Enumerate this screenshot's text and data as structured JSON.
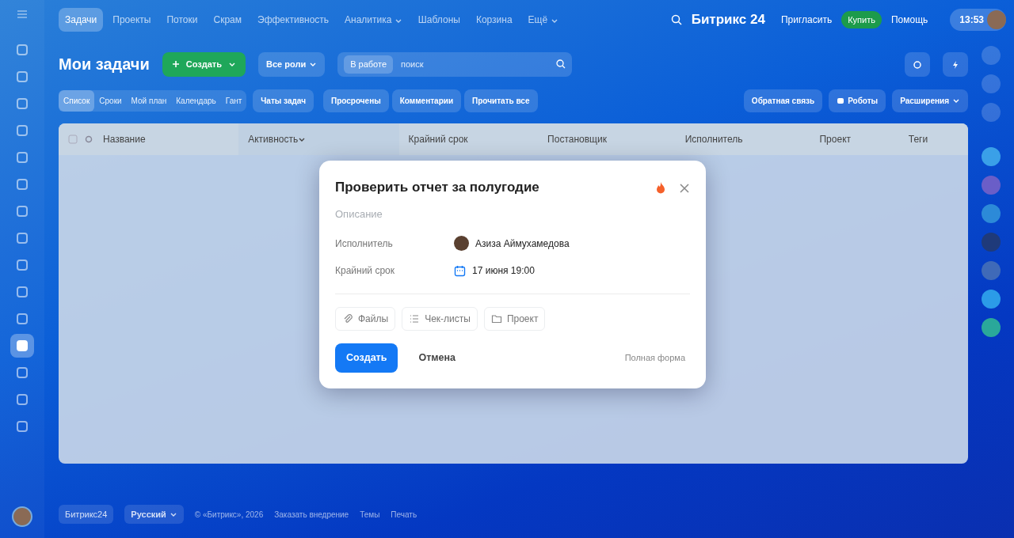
{
  "top_nav": {
    "items": [
      {
        "label": "Задачи",
        "selected": true,
        "has_menu": false
      },
      {
        "label": "Проекты",
        "selected": false,
        "has_menu": false
      },
      {
        "label": "Потоки",
        "selected": false,
        "has_menu": false
      },
      {
        "label": "Скрам",
        "selected": false,
        "has_menu": false
      },
      {
        "label": "Эффективность",
        "selected": false,
        "has_menu": false
      },
      {
        "label": "Аналитика",
        "selected": false,
        "has_menu": true
      },
      {
        "label": "Шаблоны",
        "selected": false,
        "has_menu": false
      },
      {
        "label": "Корзина",
        "selected": false,
        "has_menu": false
      },
      {
        "label": "Ещё",
        "selected": false,
        "has_menu": true
      }
    ],
    "brand": "Битрикс 24",
    "invite": "Пригласить",
    "buy": "Купить",
    "help": "Помощь",
    "clock": "13:53"
  },
  "left_sidebar": {
    "items": [
      {
        "selected": false
      },
      {
        "selected": false
      },
      {
        "selected": false
      },
      {
        "selected": false
      },
      {
        "selected": false
      },
      {
        "selected": false
      },
      {
        "selected": false
      },
      {
        "selected": false
      },
      {
        "selected": false
      },
      {
        "selected": false
      },
      {
        "selected": false
      },
      {
        "selected": true
      },
      {
        "selected": false
      },
      {
        "selected": false
      },
      {
        "selected": false
      }
    ]
  },
  "toolbar": {
    "title": "Мои задачи",
    "create": "Создать",
    "roles": "Все роли",
    "filter_chip": "В работе",
    "search": {
      "placeholder": "поиск"
    }
  },
  "views": [
    {
      "label": "Список",
      "selected": true
    },
    {
      "label": "Сроки",
      "selected": false
    },
    {
      "label": "Мой план",
      "selected": false
    },
    {
      "label": "Календарь",
      "selected": false
    },
    {
      "label": "Гант",
      "selected": false
    }
  ],
  "actions": [
    "Чаты задач",
    "Просрочены",
    "Комментарии",
    "Прочитать все"
  ],
  "right_actions": [
    {
      "label": "Обратная связь",
      "kind": "plain"
    },
    {
      "label": "Роботы",
      "kind": "icon"
    },
    {
      "label": "Расширения",
      "kind": "split"
    }
  ],
  "table": {
    "columns": [
      {
        "label": "Название",
        "sorted": false
      },
      {
        "label": "Активность",
        "sorted": true
      },
      {
        "label": "Крайний срок",
        "sorted": false
      },
      {
        "label": "Постановщик",
        "sorted": false
      },
      {
        "label": "Исполнитель",
        "sorted": false
      },
      {
        "label": "Проект",
        "sorted": false
      },
      {
        "label": "Теги",
        "sorted": false
      }
    ]
  },
  "footer": {
    "brand": "Битрикс24",
    "language": "Русский",
    "links": [
      "© «Битрикс», 2026",
      "Заказать внедрение",
      "Темы",
      "Печать"
    ]
  },
  "dialog": {
    "title": "Проверить отчет за полугодие",
    "important": true,
    "description": {
      "placeholder": "Описание"
    },
    "fields": [
      {
        "label": "Исполнитель",
        "value": "Азиза Аймухамедова",
        "kind": "person"
      },
      {
        "label": "Крайний срок",
        "value": "17 июня 19:00",
        "kind": "date"
      }
    ],
    "attachments": [
      {
        "label": "Файлы",
        "kind": "clip"
      },
      {
        "label": "Чек-листы",
        "kind": "list"
      },
      {
        "label": "Проект",
        "kind": "folder"
      }
    ],
    "create": "Создать",
    "cancel": "Отмена",
    "full_form": "Полная форма"
  }
}
